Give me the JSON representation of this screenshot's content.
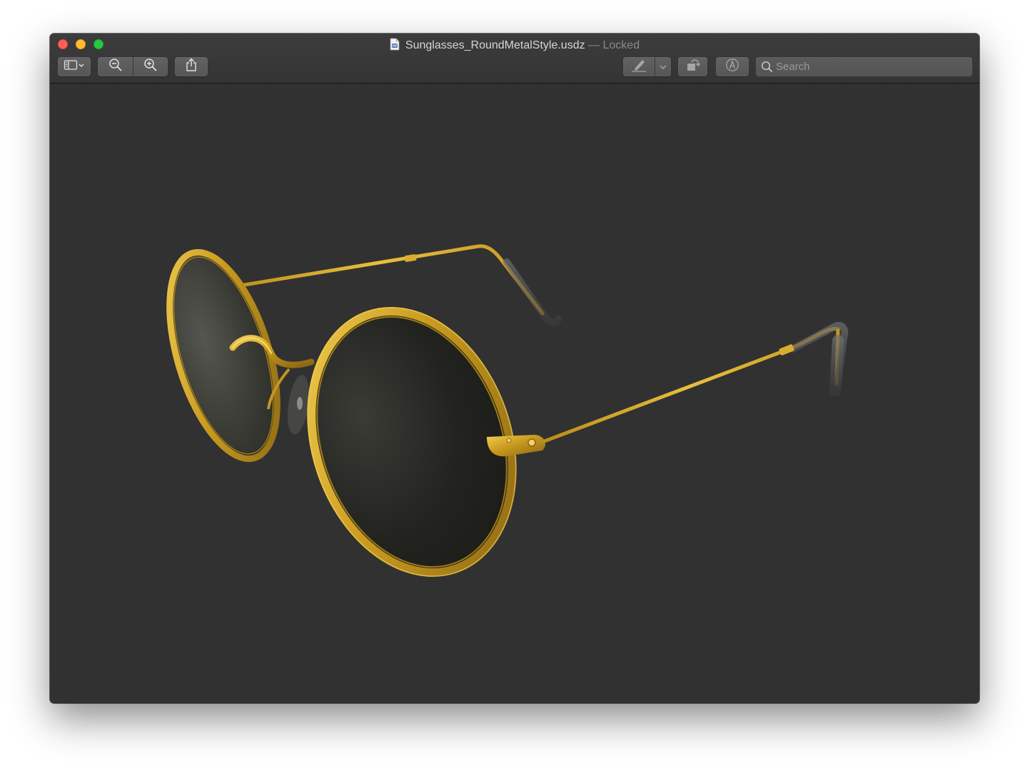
{
  "window": {
    "filename": "Sunglasses_RoundMetalStyle.usdz",
    "separator": "—",
    "status": "Locked"
  },
  "toolbar": {
    "buttons": [
      {
        "name": "sidebar-toggle",
        "icon": "sidebar-icon"
      },
      {
        "name": "zoom-out",
        "icon": "zoom-out-icon"
      },
      {
        "name": "zoom-in",
        "icon": "zoom-in-icon"
      },
      {
        "name": "share",
        "icon": "share-icon"
      },
      {
        "name": "markup-pen",
        "icon": "pen-icon",
        "enabled": false
      },
      {
        "name": "rotate",
        "icon": "rotate-icon",
        "enabled": false
      },
      {
        "name": "markup",
        "icon": "markup-icon",
        "enabled": false
      }
    ]
  },
  "search": {
    "placeholder": "Search",
    "value": ""
  },
  "viewer": {
    "model": "sunglasses-3d-model",
    "background_color": "#313131",
    "frame_color": "#d4a52a",
    "lens_color": "#1e1f1b"
  }
}
